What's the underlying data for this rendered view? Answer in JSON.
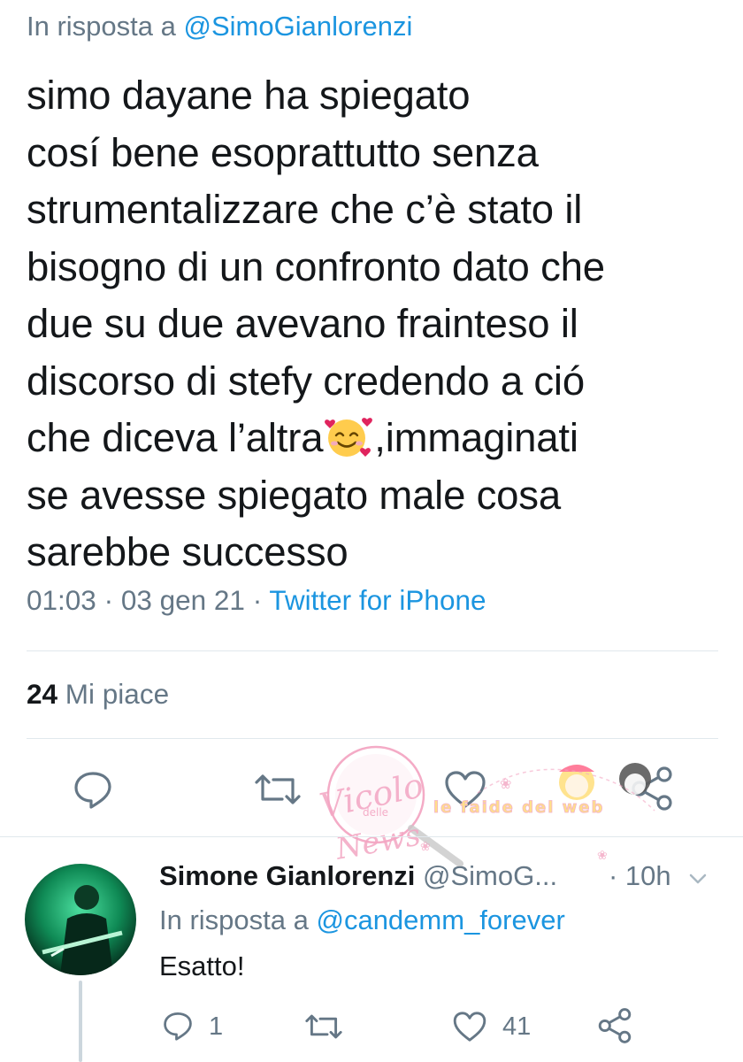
{
  "tweet": {
    "reply_to_prefix": "In risposta a ",
    "reply_to_handle": "@SimoGianlorenzi",
    "lines": [
      "simo dayane ha spiegato",
      "cosí bene esoprattutto senza",
      "strumentalizzare che c’è stato il",
      "bisogno di un confronto dato che",
      "due su due avevano frainteso il",
      "discorso di stefy credendo a ció"
    ],
    "line7_before": "che diceva l’altra",
    "emoji": "smiling-face-with-hearts",
    "line7_after": ",immaginati",
    "lines_end": [
      "se avesse spiegato male cosa",
      "sarebbe successo"
    ],
    "time_date": "01:03 · 03 gen 21 · ",
    "source": "Twitter for iPhone",
    "likes_count": "24",
    "likes_label": " Mi piace"
  },
  "watermark": {
    "brand_line1": "Vicolo",
    "brand_line2": "delle",
    "brand_line3": "News",
    "tagline": "le faide del web"
  },
  "reply": {
    "name": "Simone Gianlorenzi",
    "handle": " @SimoG...",
    "time": "· 10h",
    "reply_to_prefix": "In risposta a ",
    "reply_to_handle": "@candemm_forever",
    "text": "Esatto!",
    "replies_count": "1",
    "likes_count": "41"
  },
  "colors": {
    "text": "#14171a",
    "secondary": "#657786",
    "link": "#1b95e0",
    "divider": "#e1e8ed"
  }
}
